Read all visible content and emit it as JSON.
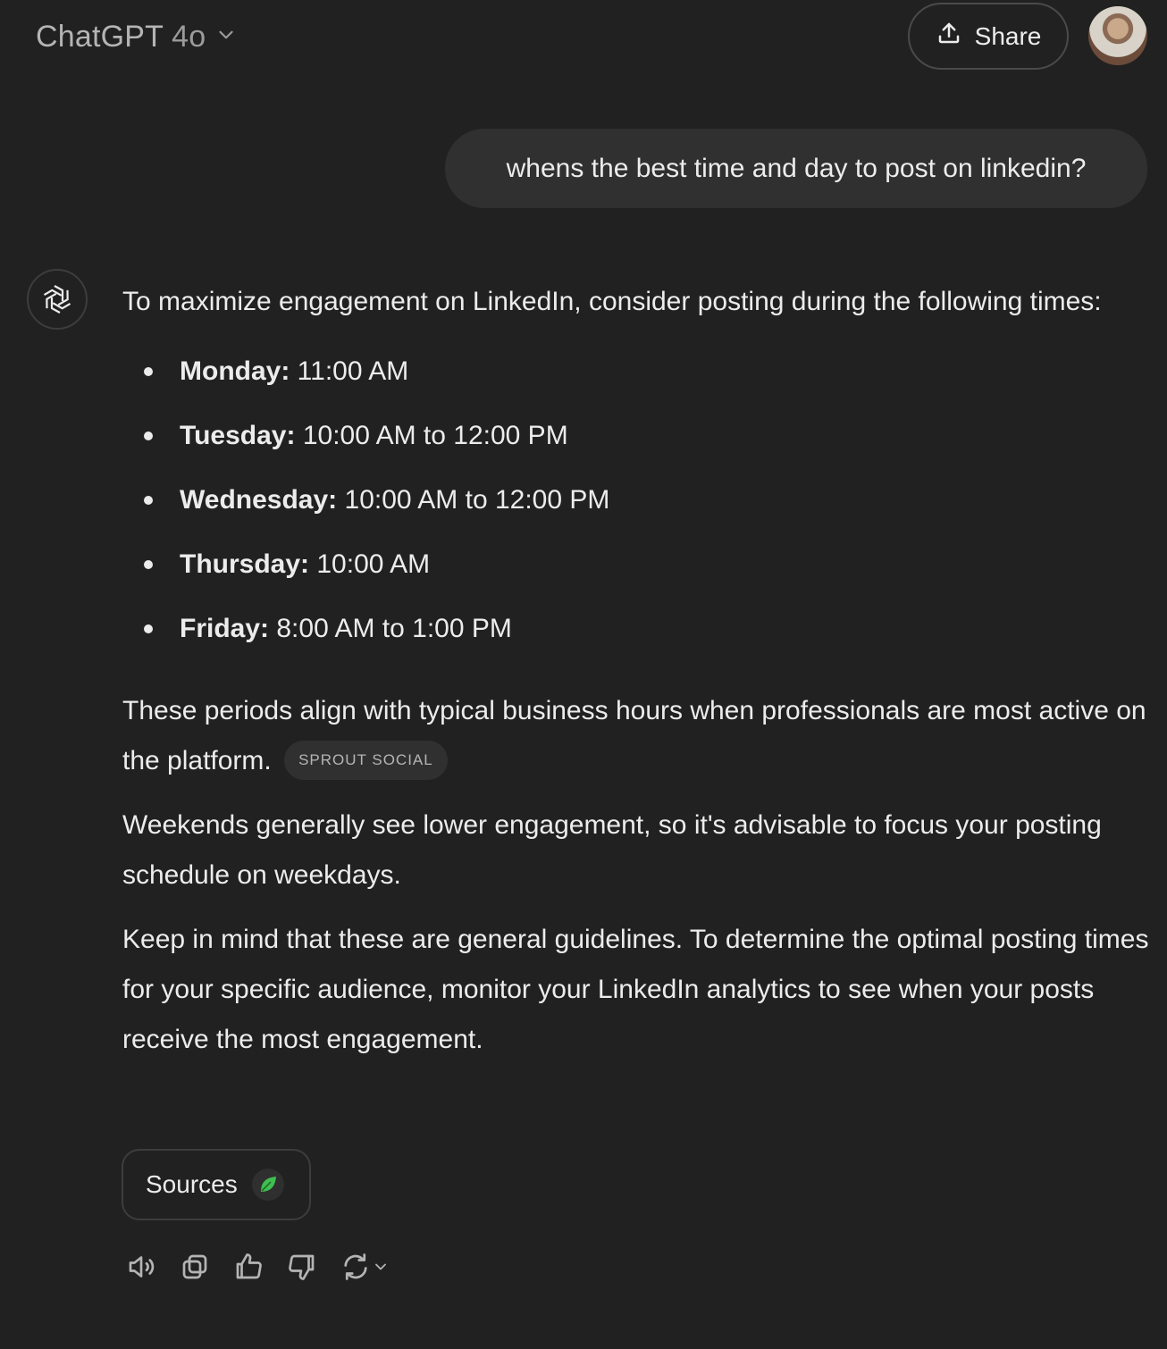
{
  "header": {
    "model_name": "ChatGPT",
    "model_version": "4o",
    "share_label": "Share"
  },
  "conversation": {
    "user_message": "whens the best time and day to post on linkedin?",
    "assistant": {
      "intro": "To maximize engagement on LinkedIn, consider posting during the following times:",
      "schedule": [
        {
          "day": "Monday:",
          "time": "11:00 AM"
        },
        {
          "day": "Tuesday:",
          "time": "10:00 AM to 12:00 PM"
        },
        {
          "day": "Wednesday:",
          "time": "10:00 AM to 12:00 PM"
        },
        {
          "day": "Thursday:",
          "time": "10:00 AM"
        },
        {
          "day": "Friday:",
          "time": "8:00 AM to 1:00 PM"
        }
      ],
      "paragraph_business_hours": "These periods align with typical business hours when professionals are most active on the platform.",
      "citation": "SPROUT SOCIAL",
      "paragraph_weekends": "Weekends generally see lower engagement, so it's advisable to focus your posting schedule on weekdays.",
      "paragraph_guidelines": "Keep in mind that these are general guidelines. To determine the optimal posting times for your specific audience, monitor your LinkedIn analytics to see when your posts receive the most engagement.",
      "sources_label": "Sources"
    }
  },
  "icons": {
    "model_dropdown": "chevron-down-icon",
    "share": "upload-icon",
    "assistant": "openai-logo-icon",
    "source_favicon": "sprout-social-leaf-icon",
    "actions": [
      "speaker-icon",
      "copy-icon",
      "thumbs-up-icon",
      "thumbs-down-icon",
      "regenerate-icon",
      "chevron-down-icon"
    ]
  },
  "colors": {
    "background": "#212121",
    "bubble": "#303030",
    "text": "#ececec",
    "muted": "#b4b4b4",
    "source_green": "#3fbf4f"
  }
}
